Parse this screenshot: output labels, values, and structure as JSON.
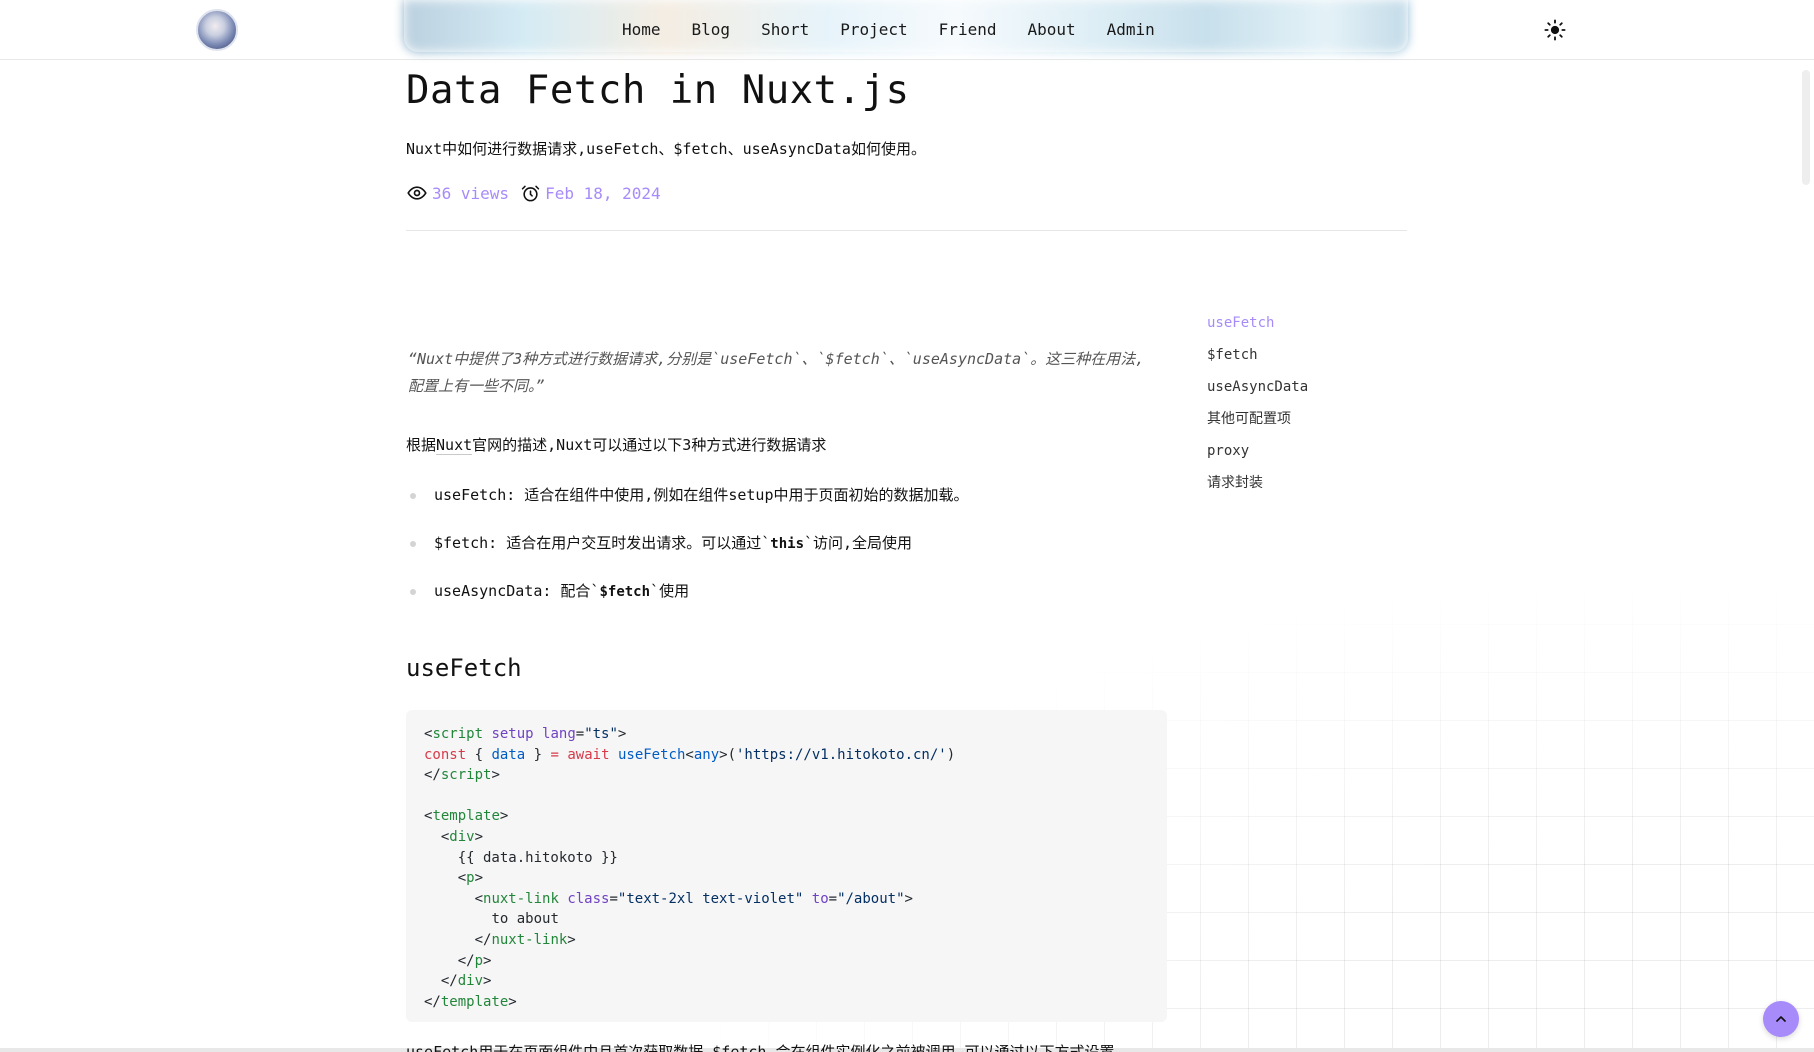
{
  "header": {
    "nav": [
      {
        "label": "Home"
      },
      {
        "label": "Blog"
      },
      {
        "label": "Short"
      },
      {
        "label": "Project"
      },
      {
        "label": "Friend"
      },
      {
        "label": "About"
      },
      {
        "label": "Admin"
      }
    ],
    "theme_icon": "sun-icon"
  },
  "article": {
    "title": "Data Fetch in Nuxt.js",
    "subtitle": "Nuxt中如何进行数据请求,useFetch、$fetch、useAsyncData如何使用。",
    "views": "36 views",
    "date": "Feb 18, 2024",
    "quote": "“Nuxt中提供了3种方式进行数据请求,分别是`useFetch`、`$fetch`、`useAsyncData`。这三种在用法,配置上有一些不同。”",
    "intro_prefix": "根据",
    "intro_link": "Nuxt",
    "intro_suffix": "官网的描述,Nuxt可以通过以下3种方式进行数据请求",
    "list": [
      {
        "prefix": "useFetch: 适合在组件中使用,例如在组件setup中用于页面初始的数据加载。",
        "code": "",
        "suffix": ""
      },
      {
        "prefix": "$fetch: 适合在用户交互时发出请求。可以通过`",
        "code": "this",
        "suffix": "`访问,全局使用"
      },
      {
        "prefix": "useAsyncData: 配合`",
        "code": "$fetch",
        "suffix": "`使用"
      }
    ],
    "section_heading": "useFetch",
    "next_line": "useFetch用于在页面组件中且首次获取数据,$fetch 会在组件实例化之前被调用,可以通过以下方式设置"
  },
  "toc": [
    "useFetch",
    "$fetch",
    "useAsyncData",
    "其他可配置项",
    "proxy",
    "请求封装"
  ],
  "colors": {
    "accent": "#a78bfa"
  }
}
